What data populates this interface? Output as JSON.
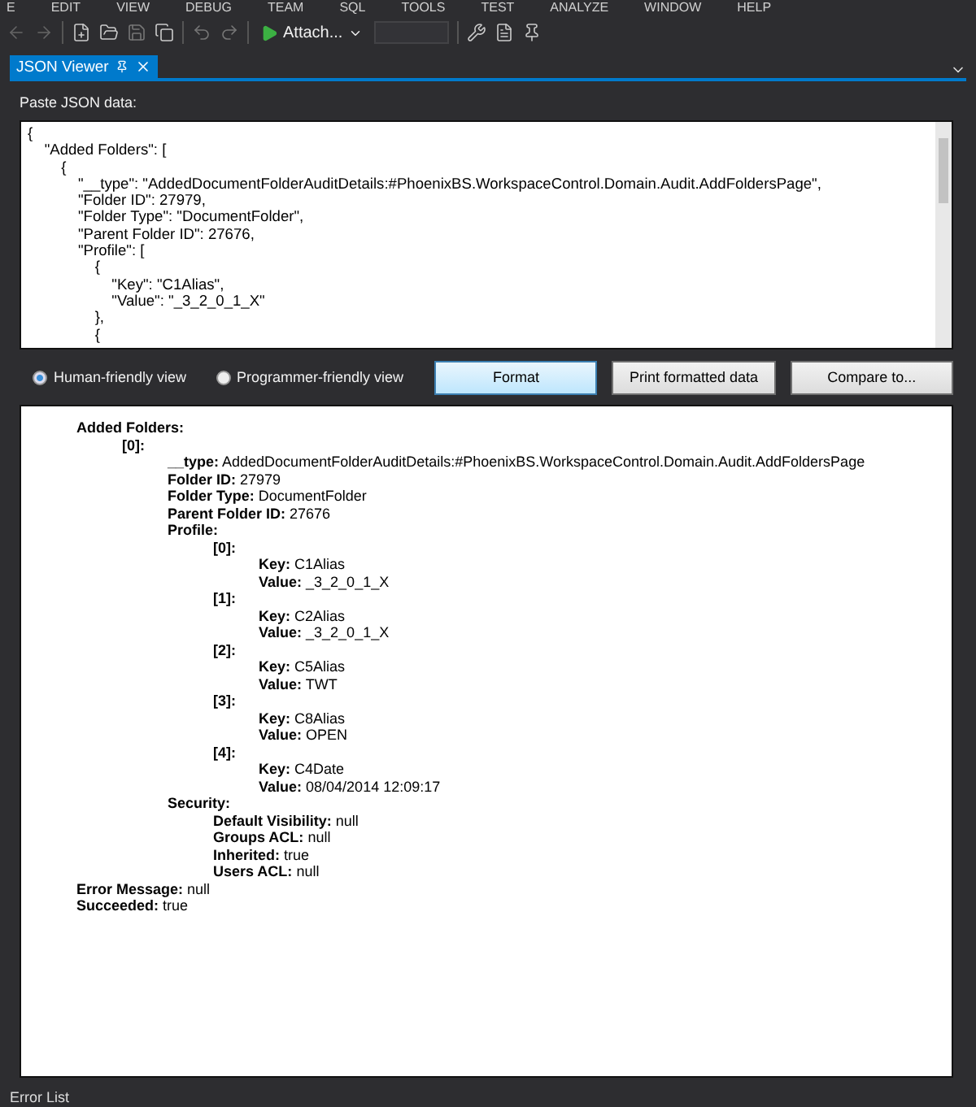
{
  "menu": [
    "E",
    "EDIT",
    "VIEW",
    "DEBUG",
    "TEAM",
    "SQL",
    "TOOLS",
    "TEST",
    "ANALYZE",
    "WINDOW",
    "HELP"
  ],
  "toolbar": {
    "attach_label": "Attach..."
  },
  "tabs": [
    {
      "label": "JSON Viewer",
      "selected": true
    }
  ],
  "input_label": "Paste JSON data:",
  "json_lines": [
    "{",
    "    \"Added Folders\": [",
    "        {",
    "            \"__type\": \"AddedDocumentFolderAuditDetails:#PhoenixBS.WorkspaceControl.Domain.Audit.AddFoldersPage\",",
    "            \"Folder ID\": 27979,",
    "            \"Folder Type\": \"DocumentFolder\",",
    "            \"Parent Folder ID\": 27676,",
    "            \"Profile\": [",
    "                {",
    "                    \"Key\": \"C1Alias\",",
    "                    \"Value\": \"_3_2_0_1_X\"",
    "                },",
    "                {"
  ],
  "views": [
    {
      "label": "Human-friendly view",
      "selected": true
    },
    {
      "label": "Programmer-friendly view",
      "selected": false
    }
  ],
  "buttons": [
    {
      "label": "Format",
      "focused": true
    },
    {
      "label": "Print formatted data",
      "focused": false
    },
    {
      "label": "Compare to...",
      "focused": false
    }
  ],
  "output": [
    {
      "key": "Added Folders:",
      "children": [
        {
          "key": "[0]:",
          "children": [
            {
              "key": "__type:",
              "value": "AddedDocumentFolderAuditDetails:#PhoenixBS.WorkspaceControl.Domain.Audit.AddFoldersPage"
            },
            {
              "key": "Folder ID:",
              "value": "27979"
            },
            {
              "key": "Folder Type:",
              "value": "DocumentFolder"
            },
            {
              "key": "Parent Folder ID:",
              "value": "27676"
            },
            {
              "key": "Profile:",
              "children": [
                {
                  "key": "[0]:",
                  "children": [
                    {
                      "key": "Key:",
                      "value": "C1Alias"
                    },
                    {
                      "key": "Value:",
                      "value": "_3_2_0_1_X"
                    }
                  ]
                },
                {
                  "key": "[1]:",
                  "children": [
                    {
                      "key": "Key:",
                      "value": "C2Alias"
                    },
                    {
                      "key": "Value:",
                      "value": "_3_2_0_1_X"
                    }
                  ]
                },
                {
                  "key": "[2]:",
                  "children": [
                    {
                      "key": "Key:",
                      "value": "C5Alias"
                    },
                    {
                      "key": "Value:",
                      "value": "TWT"
                    }
                  ]
                },
                {
                  "key": "[3]:",
                  "children": [
                    {
                      "key": "Key:",
                      "value": "C8Alias"
                    },
                    {
                      "key": "Value:",
                      "value": "OPEN"
                    }
                  ]
                },
                {
                  "key": "[4]:",
                  "children": [
                    {
                      "key": "Key:",
                      "value": "C4Date"
                    },
                    {
                      "key": "Value:",
                      "value": "08/04/2014 12:09:17"
                    }
                  ]
                }
              ]
            },
            {
              "key": "Security:",
              "children": [
                {
                  "key": "Default Visibility:",
                  "value": "null"
                },
                {
                  "key": "Groups ACL:",
                  "value": "null"
                },
                {
                  "key": "Inherited:",
                  "value": "true"
                },
                {
                  "key": "Users ACL:",
                  "value": "null"
                }
              ]
            }
          ]
        }
      ]
    },
    {
      "key": "Error Message:",
      "value": "null"
    },
    {
      "key": "Succeeded:",
      "value": "true"
    }
  ],
  "bottom_tab": "Error List"
}
